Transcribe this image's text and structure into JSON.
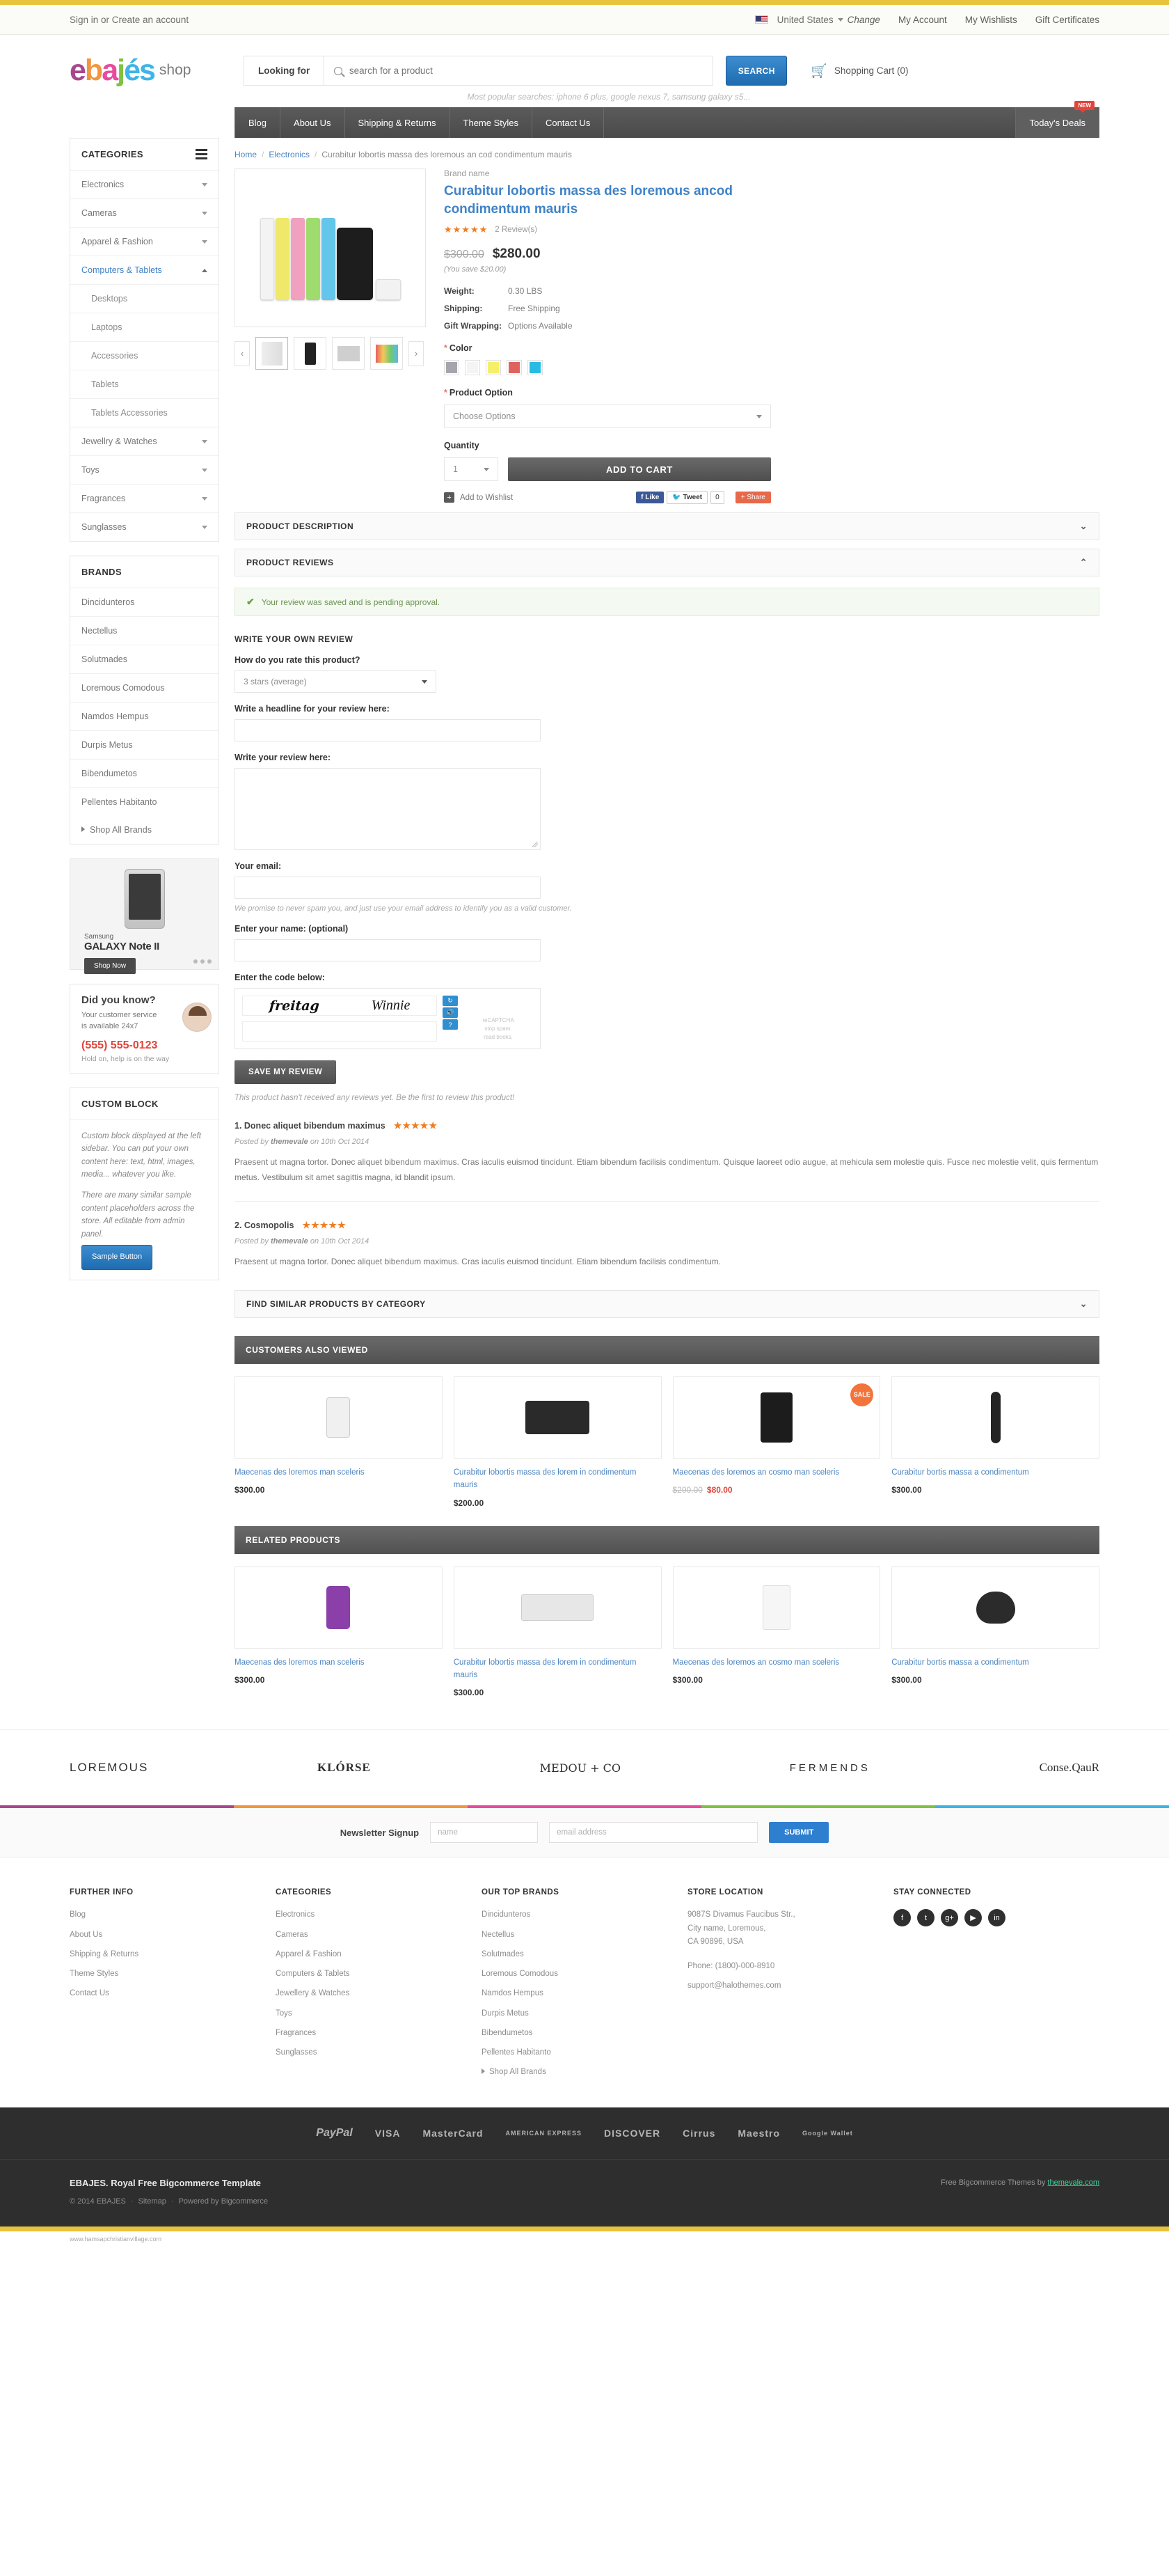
{
  "topbar": {
    "signin": "Sign in or Create an account",
    "country": "United States",
    "change": "Change",
    "links": [
      "My Account",
      "My Wishlists",
      "Gift Certificates"
    ]
  },
  "header": {
    "logo_letters": [
      "e",
      "b",
      "a",
      "j",
      "é",
      "s"
    ],
    "logo_suffix": "shop",
    "looking_for": "Looking for",
    "search_placeholder": "search for a product",
    "search_button": "SEARCH",
    "cart_label": "Shopping Cart (0)",
    "popular": "Most popular searches: iphone 6 plus, google nexus 7, samsung galaxy s5..."
  },
  "nav": {
    "items": [
      "Blog",
      "About Us",
      "Shipping & Returns",
      "Theme Styles",
      "Contact Us"
    ],
    "deals": "Today's Deals",
    "new_badge": "NEW"
  },
  "breadcrumb": {
    "home": "Home",
    "category": "Electronics",
    "current": "Curabitur lobortis massa des loremous an cod condimentum mauris"
  },
  "sidebar": {
    "categories_title": "CATEGORIES",
    "categories": [
      {
        "label": "Electronics",
        "sub": false,
        "active": false
      },
      {
        "label": "Cameras",
        "sub": false,
        "active": false
      },
      {
        "label": "Apparel & Fashion",
        "sub": false,
        "active": false
      },
      {
        "label": "Computers & Tablets",
        "sub": false,
        "active": true
      },
      {
        "label": "Desktops",
        "sub": true,
        "active": false
      },
      {
        "label": "Laptops",
        "sub": true,
        "active": false
      },
      {
        "label": "Accessories",
        "sub": true,
        "active": false
      },
      {
        "label": "Tablets",
        "sub": true,
        "active": false
      },
      {
        "label": "Tablets Accessories",
        "sub": true,
        "active": false
      },
      {
        "label": "Jewellry & Watches",
        "sub": false,
        "active": false
      },
      {
        "label": "Toys",
        "sub": false,
        "active": false
      },
      {
        "label": "Fragrances",
        "sub": false,
        "active": false
      },
      {
        "label": "Sunglasses",
        "sub": false,
        "active": false
      }
    ],
    "brands_title": "BRANDS",
    "brands": [
      "Dincidunteros",
      "Nectellus",
      "Solutmades",
      "Loremous Comodous",
      "Namdos Hempus",
      "Durpis Metus",
      "Bibendumetos",
      "Pellentes Habitanto"
    ],
    "shop_all_brands": "Shop All Brands",
    "banner": {
      "line1": "Samsung",
      "line2": "GALAXY Note II",
      "button": "Shop Now"
    },
    "didyouknow": {
      "title": "Did you know?",
      "sub1": "Your customer service",
      "sub2": "is available 24x7",
      "phone": "(555) 555-0123",
      "hold": "Hold on, help is on the way"
    },
    "custom_block": {
      "title": "CUSTOM BLOCK",
      "p1": "Custom block displayed at the left sidebar. You can put your own content here: text, html, images, media... whatever you like.",
      "p2": "There are many similar sample content placeholders across the store. All editable from admin panel.",
      "button": "Sample Button"
    }
  },
  "product": {
    "brand_name": "Brand name",
    "title": "Curabitur lobortis massa des loremous ancod condimentum mauris",
    "stars": "★★★★★",
    "review_count": "2 Review(s)",
    "old_price": "$300.00",
    "price": "$280.00",
    "you_save": "(You save $20.00)",
    "specs": [
      {
        "key": "Weight:",
        "value": "0.30 LBS"
      },
      {
        "key": "Shipping:",
        "value": "Free Shipping"
      },
      {
        "key": "Gift Wrapping:",
        "value": "Options Available"
      }
    ],
    "color_label": "Color",
    "colors": [
      "#a5a5ad",
      "#f4f4f4",
      "#f5f06a",
      "#e0625f",
      "#29bce3"
    ],
    "option_label": "Product Option",
    "option_value": "Choose Options",
    "quantity_label": "Quantity",
    "quantity_value": "1",
    "add_to_cart": "ADD TO CART",
    "add_to_wishlist": "Add to Wishlist",
    "plus": "+",
    "fb_like": "Like",
    "tweet": "Tweet",
    "tweet_count": "0",
    "share": "Share",
    "prev_arrow": "‹",
    "next_arrow": "›"
  },
  "accordions": {
    "description": "PRODUCT DESCRIPTION",
    "reviews": "PRODUCT REVIEWS",
    "similar": "FIND SIMILAR PRODUCTS BY CATEGORY",
    "chev_down": "⌄",
    "chev_up": "⌃"
  },
  "notice": {
    "text": "Your review was saved and is pending approval.",
    "icon": "✔"
  },
  "review_form": {
    "title": "WRITE YOUR OWN REVIEW",
    "rate_label": "How do you rate this product?",
    "rate_value": "3 stars (average)",
    "headline_label": "Write a headline for your review here:",
    "body_label": "Write your review here:",
    "email_label": "Your email:",
    "email_note": "We promise to never spam you, and just use your email address to identify you as a valid customer.",
    "name_label": "Enter your name: (optional)",
    "code_label": "Enter the code below:",
    "captcha_word1": "freitag",
    "captcha_word2": "Winnie",
    "captcha_brand": "reCAPTCHA",
    "captcha_note1": "stop spam.",
    "captcha_note2": "read books.",
    "save_button": "SAVE MY REVIEW",
    "no_reviews": "This product hasn't received any reviews yet. Be the first to review this product!"
  },
  "reviews": [
    {
      "title": "1. Donec aliquet bibendum maximus",
      "stars": "★★★★★",
      "meta_prefix": "Posted by ",
      "meta_author": "themevale",
      "meta_suffix": " on 10th Oct 2014",
      "body": "Praesent ut magna tortor. Donec aliquet bibendum maximus. Cras iaculis euismod tincidunt. Etiam bibendum facilisis condimentum. Quisque laoreet odio augue, at mehicula sem molestie quis. Fusce nec molestie velit, quis fermentum metus. Vestibulum sit amet sagittis magna, id blandit ipsum."
    },
    {
      "title": "2. Cosmopolis",
      "stars": "★★★★★",
      "meta_prefix": "Posted by ",
      "meta_author": "themevale",
      "meta_suffix": " on 10th Oct 2014",
      "body": "Praesent ut magna tortor. Donec aliquet bibendum maximus. Cras iaculis euismod tincidunt. Etiam bibendum facilisis condimentum."
    }
  ],
  "also_viewed": {
    "title": "CUSTOMERS ALSO VIEWED",
    "items": [
      {
        "name": "Maecenas des loremos man sceleris",
        "price": "$300.00",
        "old": "",
        "sale": false,
        "badge": ""
      },
      {
        "name": "Curabitur lobortis massa des lorem in condimentum mauris",
        "price": "$200.00",
        "old": "",
        "sale": false,
        "badge": ""
      },
      {
        "name": "Maecenas des loremos an cosmo man sceleris",
        "price": "$80.00",
        "old": "$200.00",
        "sale": true,
        "badge": "SALE"
      },
      {
        "name": "Curabitur bortis massa a condimentum",
        "price": "$300.00",
        "old": "",
        "sale": false,
        "badge": ""
      }
    ]
  },
  "related": {
    "title": "RELATED PRODUCTS",
    "items": [
      {
        "name": "Maecenas des loremos man sceleris",
        "price": "$300.00",
        "old": "",
        "sale": false,
        "badge": ""
      },
      {
        "name": "Curabitur lobortis massa des lorem in condimentum mauris",
        "price": "$300.00",
        "old": "",
        "sale": false,
        "badge": ""
      },
      {
        "name": "Maecenas des loremos an cosmo man sceleris",
        "price": "$300.00",
        "old": "",
        "sale": false,
        "badge": ""
      },
      {
        "name": "Curabitur bortis massa a condimentum",
        "price": "$300.00",
        "old": "",
        "sale": false,
        "badge": ""
      }
    ]
  },
  "brand_strip": [
    "LOREMOUS",
    "KLÓRSE",
    "MEDOU + CO",
    "FERMENDS",
    "Conse.QauR"
  ],
  "newsletter": {
    "label": "Newsletter Signup",
    "name_placeholder": "name",
    "email_placeholder": "email address",
    "button": "SUBMIT"
  },
  "footer": {
    "columns": [
      {
        "title": "FURTHER INFO",
        "links": [
          "Blog",
          "About Us",
          "Shipping & Returns",
          "Theme Styles",
          "Contact Us"
        ]
      },
      {
        "title": "CATEGORIES",
        "links": [
          "Electronics",
          "Cameras",
          "Apparel & Fashion",
          "Computers & Tablets",
          "Jewellery & Watches",
          "Toys",
          "Fragrances",
          "Sunglasses"
        ]
      },
      {
        "title": "OUR TOP BRANDS",
        "links": [
          "Dincidunteros",
          "Nectellus",
          "Solutmades",
          "Loremous Comodous",
          "Namdos Hempus",
          "Durpis Metus",
          "Bibendumetos",
          "Pellentes Habitanto"
        ]
      }
    ],
    "shop_all_brands": "Shop All Brands",
    "store_title": "STORE LOCATION",
    "store_lines": [
      "9087S Divamus Faucibus Str.,",
      "City name, Loremous,",
      "CA 90896, USA"
    ],
    "store_phone": "Phone: (1800)-000-8910",
    "store_email": "support@halothemes.com",
    "connected_title": "STAY CONNECTED",
    "social": [
      "f",
      "t",
      "g+",
      "▶",
      "in"
    ]
  },
  "payments": [
    "PayPal",
    "VISA",
    "MasterCard",
    "AMERICAN EXPRESS",
    "DISCOVER",
    "Cirrus",
    "Maestro",
    "Google Wallet"
  ],
  "bottom": {
    "title": "EBAJES. Royal Free Bigcommerce Template",
    "credit_prefix": "Free Bigcommerce Themes by ",
    "credit_link": "themevale.com",
    "copy": "© 2014 EBAJES",
    "sitemap": "Sitemap",
    "powered": "Powered by Bigcommerce",
    "micro": "www.hamsapchristianvillage.com"
  }
}
